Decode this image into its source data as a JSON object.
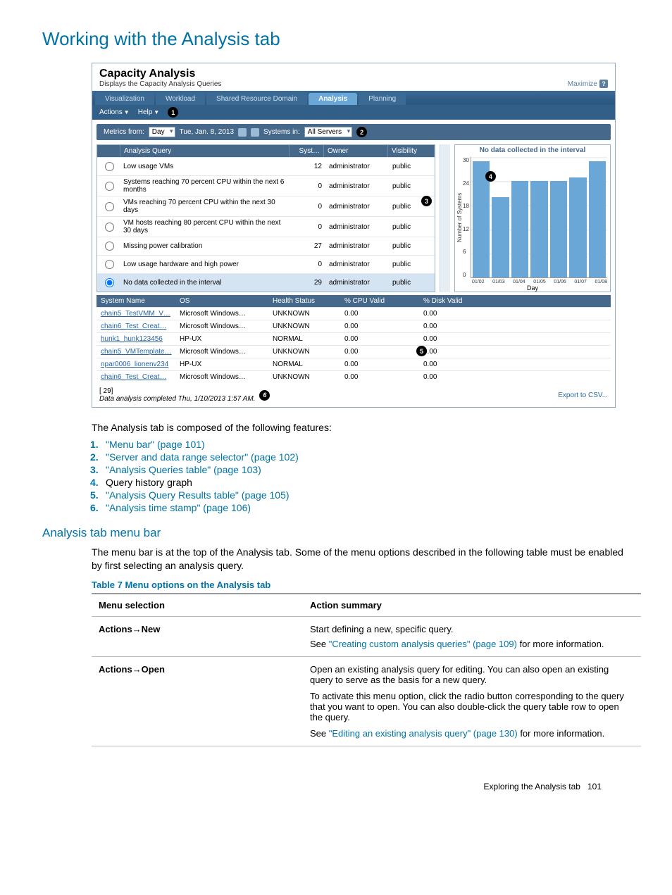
{
  "page_title": "Working with the Analysis tab",
  "screenshot": {
    "header_title": "Capacity Analysis",
    "header_sub": "Displays the Capacity Analysis Queries",
    "maximize": "Maximize",
    "tabs": [
      "Visualization",
      "Workload",
      "Shared Resource Domain",
      "Analysis",
      "Planning"
    ],
    "active_tab": "Analysis",
    "menubar": {
      "actions": "Actions",
      "help": "Help"
    },
    "metrics": {
      "label": "Metrics from:",
      "range": "Day",
      "date": "Tue, Jan. 8, 2013",
      "systems_label": "Systems in:",
      "systems_value": "All Servers"
    },
    "queries": {
      "headers": {
        "query": "Analysis Query",
        "syst": "Syst…",
        "owner": "Owner",
        "vis": "Visibility"
      },
      "rows": [
        {
          "name": "Low usage VMs",
          "syst": "12",
          "owner": "administrator",
          "vis": "public"
        },
        {
          "name": "Systems reaching 70 percent CPU within the next 6 months",
          "syst": "0",
          "owner": "administrator",
          "vis": "public"
        },
        {
          "name": "VMs reaching 70 percent CPU within the next 30 days",
          "syst": "0",
          "owner": "administrator",
          "vis": "public"
        },
        {
          "name": "VM hosts reaching 80 percent CPU within the next 30 days",
          "syst": "0",
          "owner": "administrator",
          "vis": "public"
        },
        {
          "name": "Missing power calibration",
          "syst": "27",
          "owner": "administrator",
          "vis": "public"
        },
        {
          "name": "Low usage hardware and high power",
          "syst": "0",
          "owner": "administrator",
          "vis": "public"
        },
        {
          "name": "No data collected in the interval",
          "syst": "29",
          "owner": "administrator",
          "vis": "public"
        }
      ],
      "selected_index": 6
    },
    "chart_data": {
      "type": "bar",
      "title": "No data collected in the interval",
      "ylabel": "Number of Systems",
      "xlabel": "Day",
      "ylim": [
        0,
        30
      ],
      "yticks": [
        0,
        6,
        12,
        18,
        24,
        30
      ],
      "categories": [
        "01/02",
        "01/03",
        "01/04",
        "01/05",
        "01/06",
        "01/07",
        "01/08"
      ],
      "values": [
        29,
        20,
        24,
        24,
        24,
        25,
        29
      ]
    },
    "results": {
      "headers": {
        "name": "System Name",
        "os": "OS",
        "health": "Health Status",
        "cpu": "% CPU Valid",
        "disk": "% Disk Valid"
      },
      "rows": [
        {
          "name": "chain5_TestVMM_V…",
          "os": "Microsoft Windows…",
          "health": "UNKNOWN",
          "cpu": "0.00",
          "disk": "0.00"
        },
        {
          "name": "chain6_Test_Creat…",
          "os": "Microsoft Windows…",
          "health": "UNKNOWN",
          "cpu": "0.00",
          "disk": "0.00"
        },
        {
          "name": "hunk1_hunk123456",
          "os": "HP-UX",
          "health": "NORMAL",
          "cpu": "0.00",
          "disk": "0.00"
        },
        {
          "name": "chain5_VMTemplate…",
          "os": "Microsoft Windows…",
          "health": "UNKNOWN",
          "cpu": "0.00",
          "disk": "0.00"
        },
        {
          "name": "npar0006_lionenv234",
          "os": "HP-UX",
          "health": "NORMAL",
          "cpu": "0.00",
          "disk": "0.00"
        },
        {
          "name": "chain6_Test_Creat…",
          "os": "Microsoft Windows…",
          "health": "UNKNOWN",
          "cpu": "0.00",
          "disk": "0.00"
        }
      ]
    },
    "footer": {
      "count": "[ 29]",
      "stamp": "Data analysis completed Thu, 1/10/2013 1:57 AM.",
      "export": "Export to CSV..."
    }
  },
  "intro": "The Analysis tab is composed of the following features:",
  "features": [
    {
      "text": "\"Menu bar\" (page 101)",
      "link": true
    },
    {
      "text": "\"Server and data range selector\" (page 102)",
      "link": true
    },
    {
      "text": "\"Analysis Queries table\" (page 103)",
      "link": true
    },
    {
      "text": "Query history graph",
      "link": false
    },
    {
      "text": "\"Analysis Query Results table\" (page 105)",
      "link": true
    },
    {
      "text": "\"Analysis time stamp\" (page 106)",
      "link": true
    }
  ],
  "sub_heading": "Analysis tab menu bar",
  "sub_para": "The menu bar is at the top of the Analysis tab. Some of the menu options described in the following table must be enabled by first selecting an analysis query.",
  "table_caption": "Table 7 Menu options on the Analysis tab",
  "table": {
    "head_left": "Menu selection",
    "head_right": "Action summary",
    "rows": [
      {
        "left": "Actions→New",
        "right_p1": "Start defining a new, specific query.",
        "right_p2a": "See ",
        "right_p2_link": "\"Creating custom analysis queries\" (page 109)",
        "right_p2b": " for more information."
      },
      {
        "left": "Actions→Open",
        "right_p1": "Open an existing analysis query for editing. You can also open an existing query to serve as the basis for a new query.",
        "right_p2": "To activate this menu option, click the radio button corresponding to the query that you want to open. You can also double-click the query table row to open the query.",
        "right_p3a": "See ",
        "right_p3_link": "\"Editing an existing analysis query\" (page 130)",
        "right_p3b": " for more information."
      }
    ]
  },
  "page_footer": {
    "text": "Exploring the Analysis tab",
    "num": "101"
  }
}
